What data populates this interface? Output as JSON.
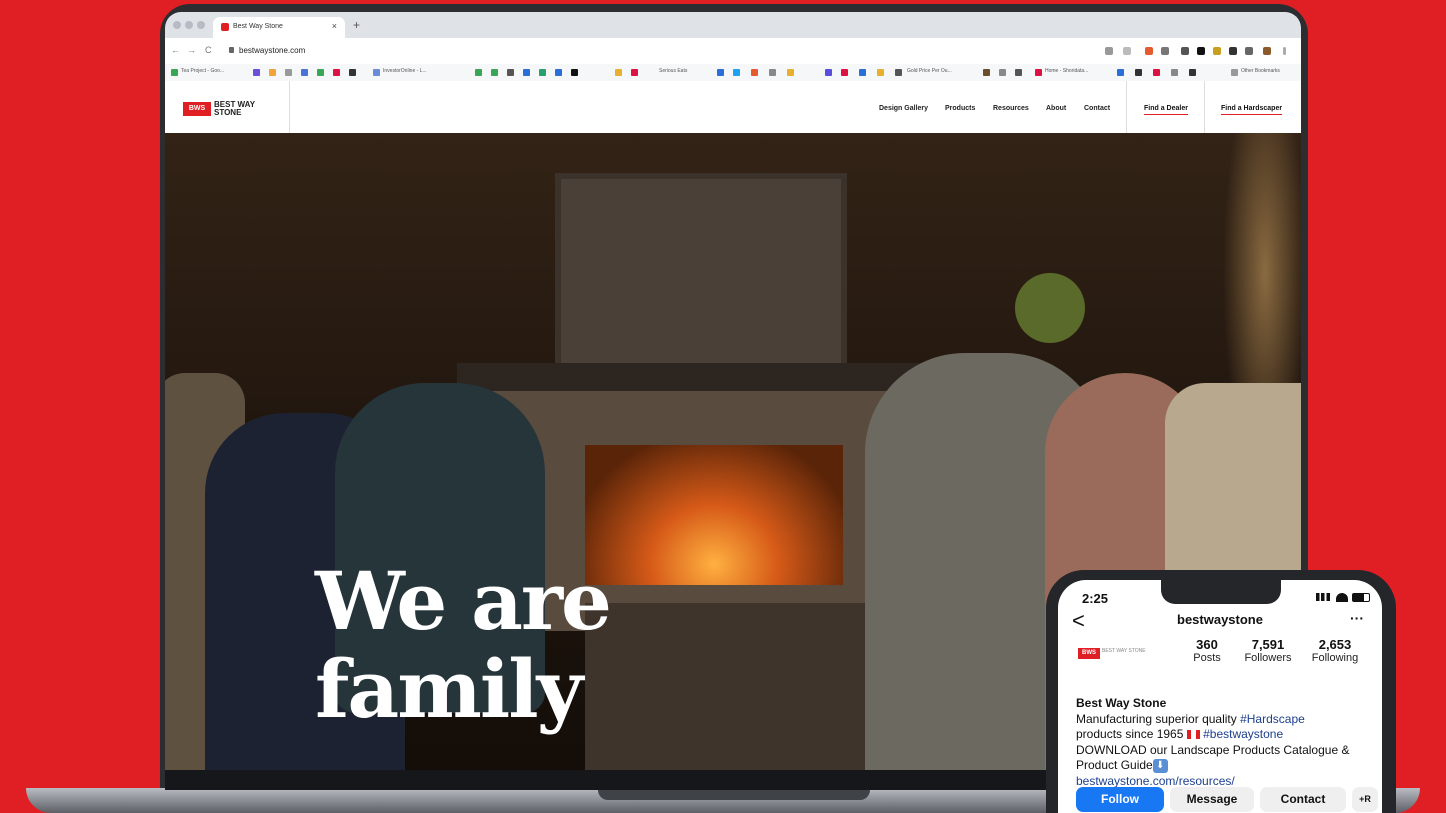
{
  "browser": {
    "tab_title": "Best Way Stone",
    "tab_close": "×",
    "new_tab": "+",
    "url": "bestwaystone.com",
    "nav": {
      "back": "←",
      "forward": "→",
      "reload": "C"
    },
    "bookmarks": [
      "Tea Project - Goo...",
      "InvestorOnline - L...",
      "Serious Eats",
      "Gold Price Per Ou...",
      "Home - Shoridata...",
      "Other Bookmarks"
    ]
  },
  "site": {
    "logo_badge": "BWS",
    "logo_text": "BEST WAY STONE",
    "nav": [
      "Design Gallery",
      "Products",
      "Resources",
      "About",
      "Contact"
    ],
    "cta_dealer": "Find a Dealer",
    "cta_hardscaper": "Find a Hardscaper",
    "hero_line1": "We are",
    "hero_line2": "family"
  },
  "phone": {
    "time": "2:25",
    "back": "<",
    "username": "bestwaystone",
    "more": "···",
    "avatar_badge": "BWS",
    "avatar_text": "BEST WAY STONE",
    "stats": [
      {
        "num": "360",
        "label": "Posts"
      },
      {
        "num": "7,591",
        "label": "Followers"
      },
      {
        "num": "2,653",
        "label": "Following"
      }
    ],
    "bio_name": "Best Way Stone",
    "bio_line1": "Manufacturing superior quality ",
    "bio_tag1": "#Hardscape",
    "bio_line2": "products since 1965 ",
    "bio_tag2": "#bestwaystone",
    "bio_line3": "DOWNLOAD our Landscape Products Catalogue &",
    "bio_line4": "Product Guide",
    "bio_link": "bestwaystone.com/resources/",
    "buttons": {
      "follow": "Follow",
      "message": "Message",
      "contact": "Contact",
      "add": "+R"
    }
  },
  "colors": {
    "brand_red": "#e01f25",
    "instagram_blue": "#1877f2",
    "link_blue": "#1c3f8f"
  }
}
